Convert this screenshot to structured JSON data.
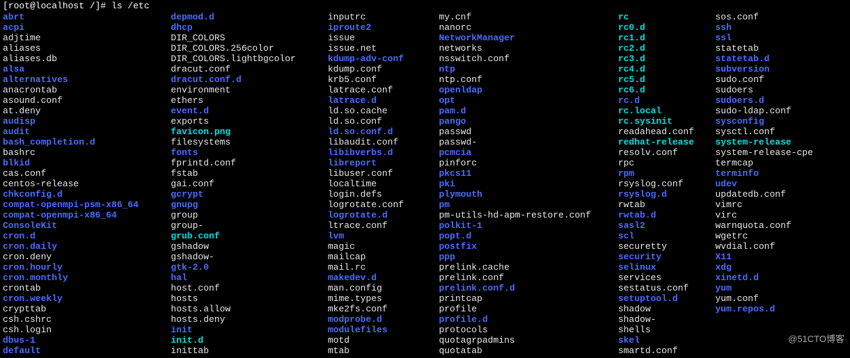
{
  "prompt": "[root@localhost /]# ls /etc",
  "watermark": "@51CTO博客",
  "columns": [
    [
      {
        "name": "abrt",
        "type": "dir"
      },
      {
        "name": "acpi",
        "type": "dir"
      },
      {
        "name": "adjtime",
        "type": "file"
      },
      {
        "name": "aliases",
        "type": "file"
      },
      {
        "name": "aliases.db",
        "type": "file"
      },
      {
        "name": "alsa",
        "type": "dir"
      },
      {
        "name": "alternatives",
        "type": "dir"
      },
      {
        "name": "anacrontab",
        "type": "file"
      },
      {
        "name": "asound.conf",
        "type": "file"
      },
      {
        "name": "at.deny",
        "type": "file"
      },
      {
        "name": "audisp",
        "type": "dir"
      },
      {
        "name": "audit",
        "type": "dir"
      },
      {
        "name": "bash_completion.d",
        "type": "dir"
      },
      {
        "name": "bashrc",
        "type": "file"
      },
      {
        "name": "blkid",
        "type": "dir"
      },
      {
        "name": "cas.conf",
        "type": "file"
      },
      {
        "name": "centos-release",
        "type": "file"
      },
      {
        "name": "chkconfig.d",
        "type": "dir"
      },
      {
        "name": "compat-openmpi-psm-x86_64",
        "type": "dir"
      },
      {
        "name": "compat-openmpi-x86_64",
        "type": "dir"
      },
      {
        "name": "ConsoleKit",
        "type": "dir"
      },
      {
        "name": "cron.d",
        "type": "dir"
      },
      {
        "name": "cron.daily",
        "type": "dir"
      },
      {
        "name": "cron.deny",
        "type": "file"
      },
      {
        "name": "cron.hourly",
        "type": "dir"
      },
      {
        "name": "cron.monthly",
        "type": "dir"
      },
      {
        "name": "crontab",
        "type": "file"
      },
      {
        "name": "cron.weekly",
        "type": "dir"
      },
      {
        "name": "crypttab",
        "type": "file"
      },
      {
        "name": "csh.cshrc",
        "type": "file"
      },
      {
        "name": "csh.login",
        "type": "file"
      },
      {
        "name": "dbus-1",
        "type": "dir"
      },
      {
        "name": "default",
        "type": "dir"
      }
    ],
    [
      {
        "name": "depmod.d",
        "type": "dir"
      },
      {
        "name": "dhcp",
        "type": "dir"
      },
      {
        "name": "DIR_COLORS",
        "type": "file"
      },
      {
        "name": "DIR_COLORS.256color",
        "type": "file"
      },
      {
        "name": "DIR_COLORS.lightbgcolor",
        "type": "file"
      },
      {
        "name": "dracut.conf",
        "type": "file"
      },
      {
        "name": "dracut.conf.d",
        "type": "dir"
      },
      {
        "name": "environment",
        "type": "file"
      },
      {
        "name": "ethers",
        "type": "file"
      },
      {
        "name": "event.d",
        "type": "dir"
      },
      {
        "name": "exports",
        "type": "file"
      },
      {
        "name": "favicon.png",
        "type": "img"
      },
      {
        "name": "filesystems",
        "type": "file"
      },
      {
        "name": "fonts",
        "type": "dir"
      },
      {
        "name": "fprintd.conf",
        "type": "file"
      },
      {
        "name": "fstab",
        "type": "file"
      },
      {
        "name": "gai.conf",
        "type": "file"
      },
      {
        "name": "gcrypt",
        "type": "dir"
      },
      {
        "name": "gnupg",
        "type": "dir"
      },
      {
        "name": "group",
        "type": "file"
      },
      {
        "name": "group-",
        "type": "file"
      },
      {
        "name": "grub.conf",
        "type": "link"
      },
      {
        "name": "gshadow",
        "type": "file"
      },
      {
        "name": "gshadow-",
        "type": "file"
      },
      {
        "name": "gtk-2.0",
        "type": "dir"
      },
      {
        "name": "hal",
        "type": "dir"
      },
      {
        "name": "host.conf",
        "type": "file"
      },
      {
        "name": "hosts",
        "type": "file"
      },
      {
        "name": "hosts.allow",
        "type": "file"
      },
      {
        "name": "hosts.deny",
        "type": "file"
      },
      {
        "name": "init",
        "type": "dir"
      },
      {
        "name": "init.d",
        "type": "link"
      },
      {
        "name": "inittab",
        "type": "file"
      }
    ],
    [
      {
        "name": "inputrc",
        "type": "file"
      },
      {
        "name": "iproute2",
        "type": "dir"
      },
      {
        "name": "issue",
        "type": "file"
      },
      {
        "name": "issue.net",
        "type": "file"
      },
      {
        "name": "kdump-adv-conf",
        "type": "dir"
      },
      {
        "name": "kdump.conf",
        "type": "file"
      },
      {
        "name": "krb5.conf",
        "type": "file"
      },
      {
        "name": "latrace.conf",
        "type": "file"
      },
      {
        "name": "latrace.d",
        "type": "dir"
      },
      {
        "name": "ld.so.cache",
        "type": "file"
      },
      {
        "name": "ld.so.conf",
        "type": "file"
      },
      {
        "name": "ld.so.conf.d",
        "type": "dir"
      },
      {
        "name": "libaudit.conf",
        "type": "file"
      },
      {
        "name": "libibverbs.d",
        "type": "dir"
      },
      {
        "name": "libreport",
        "type": "dir"
      },
      {
        "name": "libuser.conf",
        "type": "file"
      },
      {
        "name": "localtime",
        "type": "file"
      },
      {
        "name": "login.defs",
        "type": "file"
      },
      {
        "name": "logrotate.conf",
        "type": "file"
      },
      {
        "name": "logrotate.d",
        "type": "dir"
      },
      {
        "name": "ltrace.conf",
        "type": "file"
      },
      {
        "name": "lvm",
        "type": "dir"
      },
      {
        "name": "magic",
        "type": "file"
      },
      {
        "name": "mailcap",
        "type": "file"
      },
      {
        "name": "mail.rc",
        "type": "file"
      },
      {
        "name": "makedev.d",
        "type": "dir"
      },
      {
        "name": "man.config",
        "type": "file"
      },
      {
        "name": "mime.types",
        "type": "file"
      },
      {
        "name": "mke2fs.conf",
        "type": "file"
      },
      {
        "name": "modprobe.d",
        "type": "dir"
      },
      {
        "name": "modulefiles",
        "type": "dir"
      },
      {
        "name": "motd",
        "type": "file"
      },
      {
        "name": "mtab",
        "type": "file"
      }
    ],
    [
      {
        "name": "my.cnf",
        "type": "file"
      },
      {
        "name": "nanorc",
        "type": "file"
      },
      {
        "name": "NetworkManager",
        "type": "dir"
      },
      {
        "name": "networks",
        "type": "file"
      },
      {
        "name": "nsswitch.conf",
        "type": "file"
      },
      {
        "name": "ntp",
        "type": "dir"
      },
      {
        "name": "ntp.conf",
        "type": "file"
      },
      {
        "name": "openldap",
        "type": "dir"
      },
      {
        "name": "opt",
        "type": "dir"
      },
      {
        "name": "pam.d",
        "type": "dir"
      },
      {
        "name": "pango",
        "type": "dir"
      },
      {
        "name": "passwd",
        "type": "file"
      },
      {
        "name": "passwd-",
        "type": "file"
      },
      {
        "name": "pcmcia",
        "type": "dir"
      },
      {
        "name": "pinforc",
        "type": "file"
      },
      {
        "name": "pkcs11",
        "type": "dir"
      },
      {
        "name": "pki",
        "type": "dir"
      },
      {
        "name": "plymouth",
        "type": "dir"
      },
      {
        "name": "pm",
        "type": "dir"
      },
      {
        "name": "pm-utils-hd-apm-restore.conf",
        "type": "file"
      },
      {
        "name": "polkit-1",
        "type": "dir"
      },
      {
        "name": "popt.d",
        "type": "dir"
      },
      {
        "name": "postfix",
        "type": "dir"
      },
      {
        "name": "ppp",
        "type": "dir"
      },
      {
        "name": "prelink.cache",
        "type": "file"
      },
      {
        "name": "prelink.conf",
        "type": "file"
      },
      {
        "name": "prelink.conf.d",
        "type": "dir"
      },
      {
        "name": "printcap",
        "type": "file"
      },
      {
        "name": "profile",
        "type": "file"
      },
      {
        "name": "profile.d",
        "type": "dir"
      },
      {
        "name": "protocols",
        "type": "file"
      },
      {
        "name": "quotagrpadmins",
        "type": "file"
      },
      {
        "name": "quotatab",
        "type": "file"
      }
    ],
    [
      {
        "name": "rc",
        "type": "link"
      },
      {
        "name": "rc0.d",
        "type": "link"
      },
      {
        "name": "rc1.d",
        "type": "link"
      },
      {
        "name": "rc2.d",
        "type": "link"
      },
      {
        "name": "rc3.d",
        "type": "link"
      },
      {
        "name": "rc4.d",
        "type": "link"
      },
      {
        "name": "rc5.d",
        "type": "link"
      },
      {
        "name": "rc6.d",
        "type": "link"
      },
      {
        "name": "rc.d",
        "type": "dir"
      },
      {
        "name": "rc.local",
        "type": "link"
      },
      {
        "name": "rc.sysinit",
        "type": "link"
      },
      {
        "name": "readahead.conf",
        "type": "file"
      },
      {
        "name": "redhat-release",
        "type": "link"
      },
      {
        "name": "resolv.conf",
        "type": "file"
      },
      {
        "name": "rpc",
        "type": "file"
      },
      {
        "name": "rpm",
        "type": "dir"
      },
      {
        "name": "rsyslog.conf",
        "type": "file"
      },
      {
        "name": "rsyslog.d",
        "type": "dir"
      },
      {
        "name": "rwtab",
        "type": "file"
      },
      {
        "name": "rwtab.d",
        "type": "dir"
      },
      {
        "name": "sasl2",
        "type": "dir"
      },
      {
        "name": "scl",
        "type": "dir"
      },
      {
        "name": "securetty",
        "type": "file"
      },
      {
        "name": "security",
        "type": "dir"
      },
      {
        "name": "selinux",
        "type": "dir"
      },
      {
        "name": "services",
        "type": "file"
      },
      {
        "name": "sestatus.conf",
        "type": "file"
      },
      {
        "name": "setuptool.d",
        "type": "dir"
      },
      {
        "name": "shadow",
        "type": "file"
      },
      {
        "name": "shadow-",
        "type": "file"
      },
      {
        "name": "shells",
        "type": "file"
      },
      {
        "name": "skel",
        "type": "dir"
      },
      {
        "name": "smartd.conf",
        "type": "file"
      }
    ],
    [
      {
        "name": "sos.conf",
        "type": "file"
      },
      {
        "name": "ssh",
        "type": "dir"
      },
      {
        "name": "ssl",
        "type": "dir"
      },
      {
        "name": "statetab",
        "type": "file"
      },
      {
        "name": "statetab.d",
        "type": "dir"
      },
      {
        "name": "subversion",
        "type": "dir"
      },
      {
        "name": "sudo.conf",
        "type": "file"
      },
      {
        "name": "sudoers",
        "type": "file"
      },
      {
        "name": "sudoers.d",
        "type": "dir"
      },
      {
        "name": "sudo-ldap.conf",
        "type": "file"
      },
      {
        "name": "sysconfig",
        "type": "dir"
      },
      {
        "name": "sysctl.conf",
        "type": "file"
      },
      {
        "name": "system-release",
        "type": "link"
      },
      {
        "name": "system-release-cpe",
        "type": "file"
      },
      {
        "name": "termcap",
        "type": "file"
      },
      {
        "name": "terminfo",
        "type": "dir"
      },
      {
        "name": "udev",
        "type": "dir"
      },
      {
        "name": "updatedb.conf",
        "type": "file"
      },
      {
        "name": "vimrc",
        "type": "file"
      },
      {
        "name": "virc",
        "type": "file"
      },
      {
        "name": "warnquota.conf",
        "type": "file"
      },
      {
        "name": "wgetrc",
        "type": "file"
      },
      {
        "name": "wvdial.conf",
        "type": "file"
      },
      {
        "name": "X11",
        "type": "dir"
      },
      {
        "name": "xdg",
        "type": "dir"
      },
      {
        "name": "xinetd.d",
        "type": "dir"
      },
      {
        "name": "yum",
        "type": "dir"
      },
      {
        "name": "yum.conf",
        "type": "file"
      },
      {
        "name": "yum.repos.d",
        "type": "dir"
      }
    ]
  ]
}
